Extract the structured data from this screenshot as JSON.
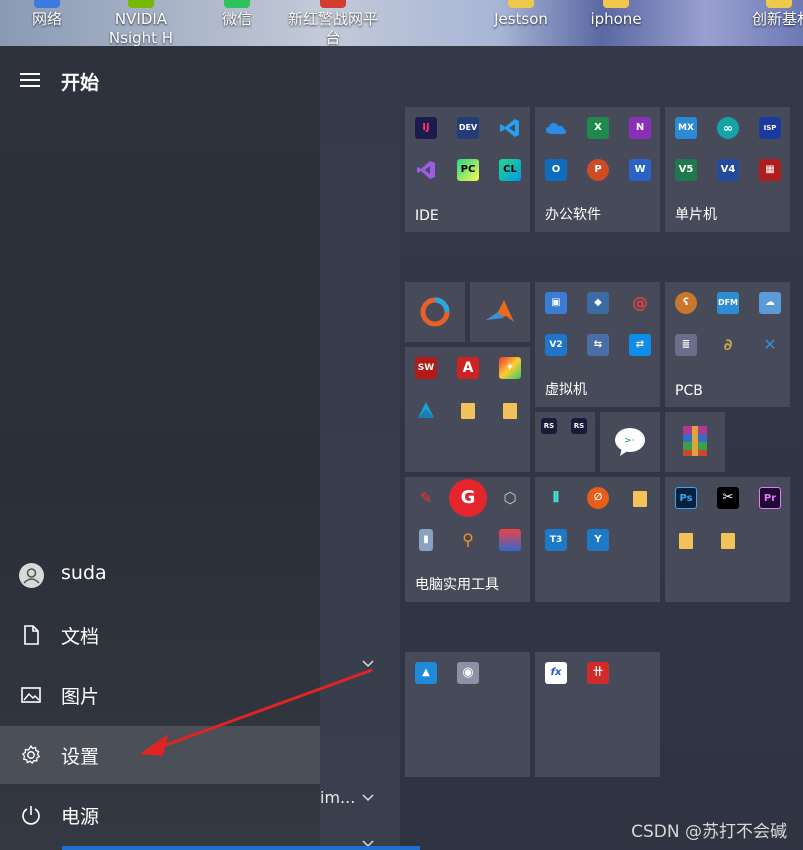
{
  "desktop": {
    "icons": [
      {
        "label": "网络",
        "color": "#3b7be0"
      },
      {
        "label": "NVIDIA Nsight H",
        "color": "#76b900"
      },
      {
        "label": "微信",
        "color": "#2ec25e"
      },
      {
        "label": "新红警战网平台",
        "color": "#d23b2e"
      },
      {
        "label": "Jestson",
        "color": "#f0c84a"
      },
      {
        "label": "iphone",
        "color": "#f0c84a"
      },
      {
        "label": "创新基材料",
        "color": "#f0c84a"
      }
    ]
  },
  "start": {
    "title": "开始",
    "nav": {
      "user": "suda",
      "documents": "文档",
      "pictures": "图片",
      "settings": "设置",
      "power": "电源"
    },
    "partial_app": "im..."
  },
  "tiles": {
    "groups": {
      "ide": "IDE",
      "office": "办公软件",
      "mcu": "单片机",
      "vm": "虚拟机",
      "pcb": "PCB",
      "tools": "电脑实用工具"
    },
    "icon_labels": {
      "ij": "IJ",
      "dev": "DEV",
      "pc": "PC",
      "cl": "CL",
      "x": "X",
      "n": "N",
      "o": "O",
      "p": "P",
      "w": "W",
      "mx": "MX",
      "dfm": "DFM",
      "ve": "V2",
      "ps": "Ps",
      "pr": "Pr",
      "sw": "SW",
      "a": "A",
      "fx": "fx",
      "rs": "RS"
    }
  },
  "watermark": "CSDN @苏打不会碱"
}
